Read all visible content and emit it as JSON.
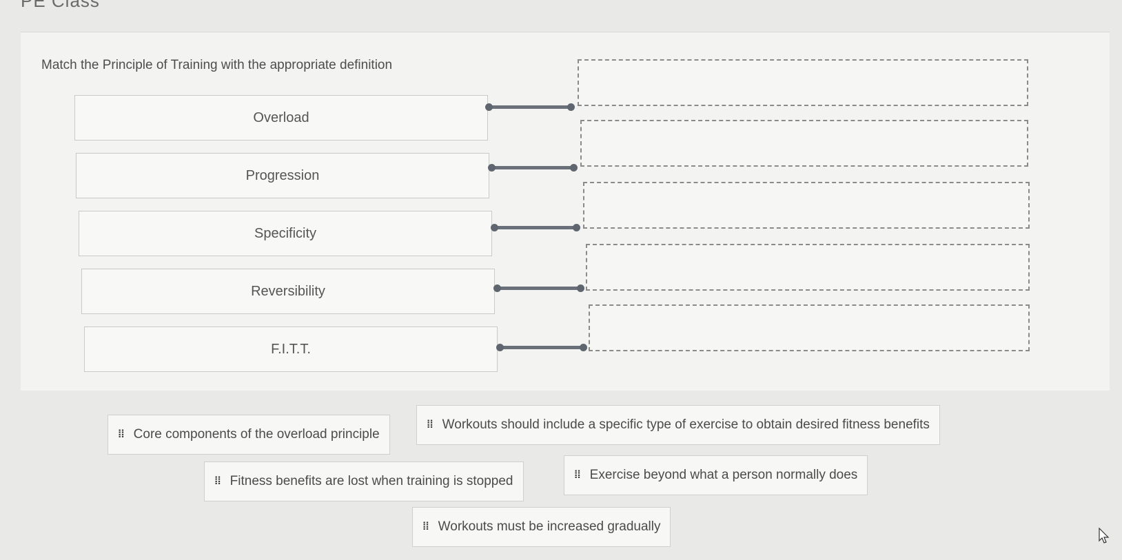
{
  "header": {
    "title_fragment": "PE Class"
  },
  "question": {
    "prompt": "Match the Principle of Training with the appropriate definition"
  },
  "terms": [
    {
      "label": "Overload"
    },
    {
      "label": "Progression"
    },
    {
      "label": "Specificity"
    },
    {
      "label": "Reversibility"
    },
    {
      "label": "F.I.T.T."
    }
  ],
  "answer_choices": [
    {
      "label": "Core components of the overload principle"
    },
    {
      "label": "Workouts should include a specific type of exercise to obtain desired fitness benefits"
    },
    {
      "label": "Fitness benefits are lost when training is stopped"
    },
    {
      "label": "Exercise beyond what a  person normally does"
    },
    {
      "label": "Workouts must be increased gradually"
    }
  ],
  "icons": {
    "drag_handle": "drag-handle-icon",
    "cursor": "mouse-pointer-icon"
  },
  "colors": {
    "connector": "#6a7079",
    "drop_border": "#8a8a8a",
    "background": "#e9e9e7"
  }
}
